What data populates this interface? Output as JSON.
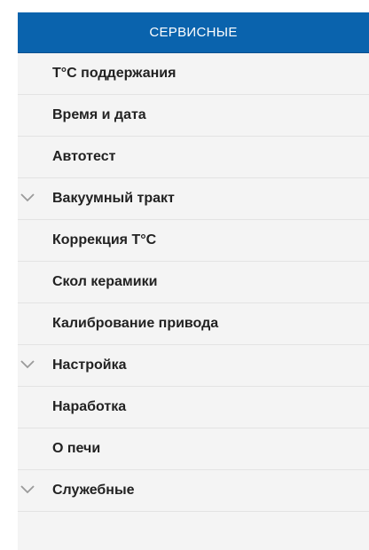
{
  "header": {
    "title": "СЕРВИСНЫЕ"
  },
  "colors": {
    "header_bg": "#0a63ad",
    "panel_bg": "#f4f4f4",
    "text": "#222222",
    "chevron": "#9a9a9a"
  },
  "menu": {
    "items": [
      {
        "label": "Т°С поддержания",
        "expandable": false
      },
      {
        "label": "Время и дата",
        "expandable": false
      },
      {
        "label": "Автотест",
        "expandable": false
      },
      {
        "label": "Вакуумный тракт",
        "expandable": true,
        "icon": "chevron-down-icon"
      },
      {
        "label": "Коррекция Т°С",
        "expandable": false
      },
      {
        "label": "Скол керамики",
        "expandable": false
      },
      {
        "label": "Калибрование привода",
        "expandable": false
      },
      {
        "label": "Настройка",
        "expandable": true,
        "icon": "chevron-down-icon"
      },
      {
        "label": "Наработка",
        "expandable": false
      },
      {
        "label": "О печи",
        "expandable": false
      },
      {
        "label": "Служебные",
        "expandable": true,
        "icon": "chevron-down-icon"
      }
    ]
  }
}
